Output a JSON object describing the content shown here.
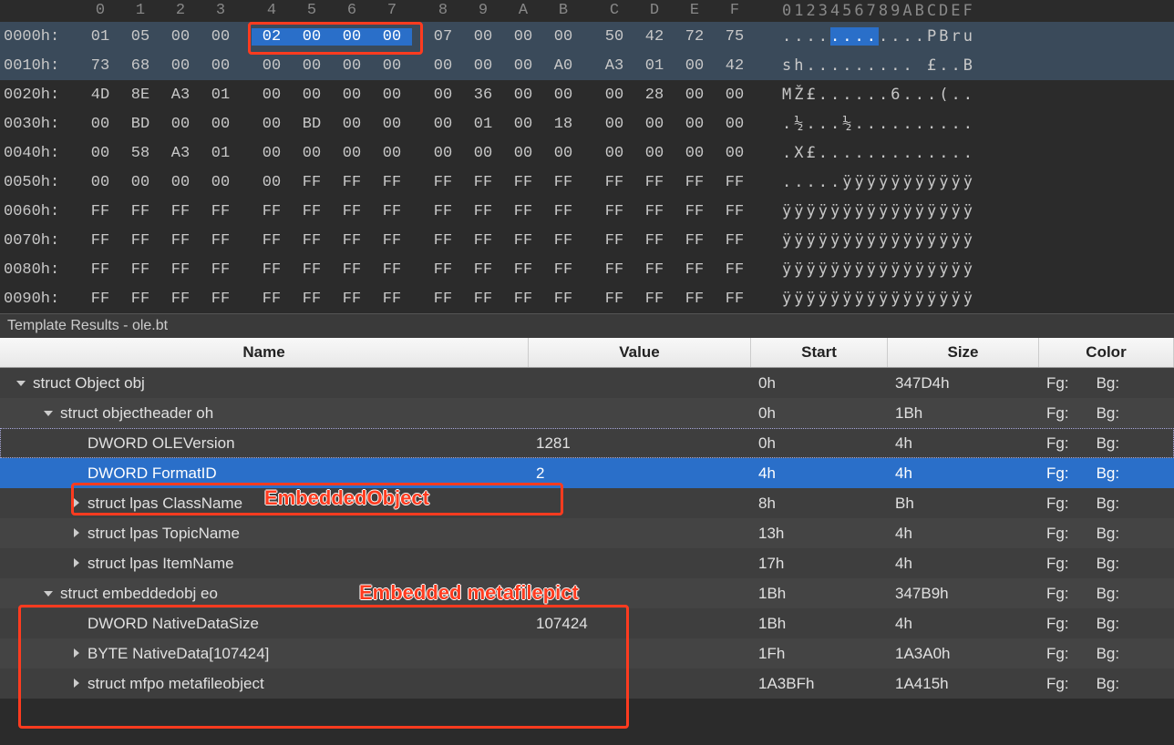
{
  "hex": {
    "header_cols": [
      "0",
      "1",
      "2",
      "3",
      "4",
      "5",
      "6",
      "7",
      "8",
      "9",
      "A",
      "B",
      "C",
      "D",
      "E",
      "F"
    ],
    "ascii_header": "0123456789ABCDEF",
    "rows": [
      {
        "offset": "0000h:",
        "bytes": [
          "01",
          "05",
          "00",
          "00",
          "02",
          "00",
          "00",
          "00",
          "07",
          "00",
          "00",
          "00",
          "50",
          "42",
          "72",
          "75"
        ],
        "ascii": "............PBru",
        "sel_start": 4,
        "sel_end": 7,
        "selrow": true
      },
      {
        "offset": "0010h:",
        "bytes": [
          "73",
          "68",
          "00",
          "00",
          "00",
          "00",
          "00",
          "00",
          "00",
          "00",
          "00",
          "A0",
          "A3",
          "01",
          "00",
          "42"
        ],
        "ascii": "sh......... £..B",
        "selrow": true
      },
      {
        "offset": "0020h:",
        "bytes": [
          "4D",
          "8E",
          "A3",
          "01",
          "00",
          "00",
          "00",
          "00",
          "00",
          "36",
          "00",
          "00",
          "00",
          "28",
          "00",
          "00"
        ],
        "ascii": "MŽ£......6...(.."
      },
      {
        "offset": "0030h:",
        "bytes": [
          "00",
          "BD",
          "00",
          "00",
          "00",
          "BD",
          "00",
          "00",
          "00",
          "01",
          "00",
          "18",
          "00",
          "00",
          "00",
          "00"
        ],
        "ascii": ".½...½.........."
      },
      {
        "offset": "0040h:",
        "bytes": [
          "00",
          "58",
          "A3",
          "01",
          "00",
          "00",
          "00",
          "00",
          "00",
          "00",
          "00",
          "00",
          "00",
          "00",
          "00",
          "00"
        ],
        "ascii": ".X£............."
      },
      {
        "offset": "0050h:",
        "bytes": [
          "00",
          "00",
          "00",
          "00",
          "00",
          "FF",
          "FF",
          "FF",
          "FF",
          "FF",
          "FF",
          "FF",
          "FF",
          "FF",
          "FF",
          "FF"
        ],
        "ascii": ".....ÿÿÿÿÿÿÿÿÿÿÿ"
      },
      {
        "offset": "0060h:",
        "bytes": [
          "FF",
          "FF",
          "FF",
          "FF",
          "FF",
          "FF",
          "FF",
          "FF",
          "FF",
          "FF",
          "FF",
          "FF",
          "FF",
          "FF",
          "FF",
          "FF"
        ],
        "ascii": "ÿÿÿÿÿÿÿÿÿÿÿÿÿÿÿÿ"
      },
      {
        "offset": "0070h:",
        "bytes": [
          "FF",
          "FF",
          "FF",
          "FF",
          "FF",
          "FF",
          "FF",
          "FF",
          "FF",
          "FF",
          "FF",
          "FF",
          "FF",
          "FF",
          "FF",
          "FF"
        ],
        "ascii": "ÿÿÿÿÿÿÿÿÿÿÿÿÿÿÿÿ"
      },
      {
        "offset": "0080h:",
        "bytes": [
          "FF",
          "FF",
          "FF",
          "FF",
          "FF",
          "FF",
          "FF",
          "FF",
          "FF",
          "FF",
          "FF",
          "FF",
          "FF",
          "FF",
          "FF",
          "FF"
        ],
        "ascii": "ÿÿÿÿÿÿÿÿÿÿÿÿÿÿÿÿ"
      },
      {
        "offset": "0090h:",
        "bytes": [
          "FF",
          "FF",
          "FF",
          "FF",
          "FF",
          "FF",
          "FF",
          "FF",
          "FF",
          "FF",
          "FF",
          "FF",
          "FF",
          "FF",
          "FF",
          "FF"
        ],
        "ascii": "ÿÿÿÿÿÿÿÿÿÿÿÿÿÿÿÿ"
      }
    ]
  },
  "panel_title": "Template Results - ole.bt",
  "columns": {
    "name": "Name",
    "value": "Value",
    "start": "Start",
    "size": "Size",
    "color": "Color"
  },
  "color_labels": {
    "fg": "Fg:",
    "bg": "Bg:"
  },
  "tree": [
    {
      "indent": 1,
      "exp": "open",
      "name": "struct Object obj",
      "value": "",
      "start": "0h",
      "size": "347D4h"
    },
    {
      "indent": 2,
      "exp": "open",
      "name": "struct objectheader oh",
      "value": "",
      "start": "0h",
      "size": "1Bh"
    },
    {
      "indent": 3,
      "exp": "none",
      "name": "DWORD OLEVersion",
      "value": "1281",
      "start": "0h",
      "size": "4h",
      "seldot": true
    },
    {
      "indent": 3,
      "exp": "none",
      "name": "DWORD FormatID",
      "value": "2",
      "start": "4h",
      "size": "4h",
      "selected": true
    },
    {
      "indent": 3,
      "exp": "closed",
      "name": "struct lpas ClassName",
      "value": "",
      "start": "8h",
      "size": "Bh"
    },
    {
      "indent": 3,
      "exp": "closed",
      "name": "struct lpas TopicName",
      "value": "",
      "start": "13h",
      "size": "4h"
    },
    {
      "indent": 3,
      "exp": "closed",
      "name": "struct lpas ItemName",
      "value": "",
      "start": "17h",
      "size": "4h"
    },
    {
      "indent": 2,
      "exp": "open",
      "name": "struct embeddedobj eo",
      "value": "",
      "start": "1Bh",
      "size": "347B9h"
    },
    {
      "indent": 3,
      "exp": "none",
      "name": "DWORD NativeDataSize",
      "value": "107424",
      "start": "1Bh",
      "size": "4h"
    },
    {
      "indent": 3,
      "exp": "closed",
      "name": "BYTE NativeData[107424]",
      "value": "",
      "start": "1Fh",
      "size": "1A3A0h"
    },
    {
      "indent": 3,
      "exp": "closed",
      "name": "struct mfpo metafileobject",
      "value": "",
      "start": "1A3BFh",
      "size": "1A415h"
    }
  ],
  "annotations": {
    "a1": "EmbeddedObject",
    "a2": "Embedded metafilepict"
  }
}
